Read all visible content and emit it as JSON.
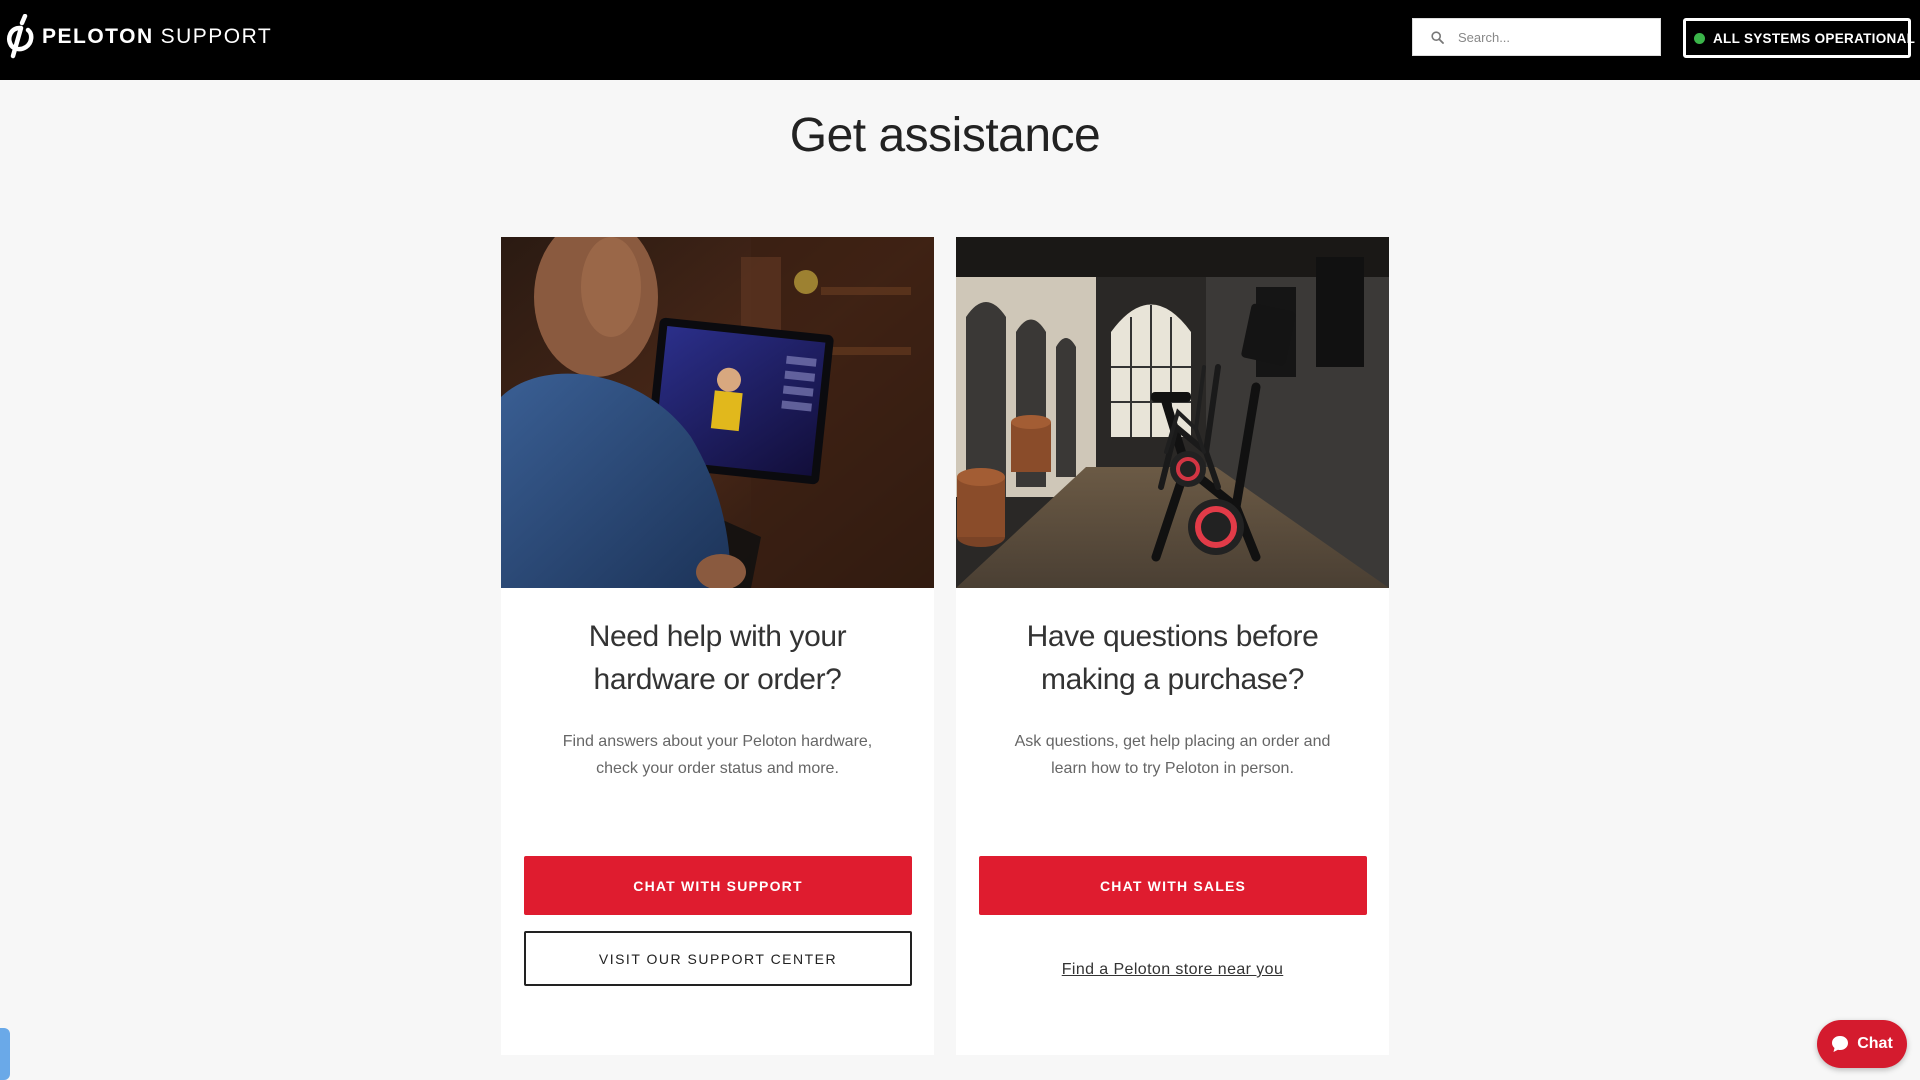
{
  "header": {
    "brand": "PELOTON",
    "brand_suffix": "SUPPORT",
    "search_placeholder": "Search...",
    "status_label": "ALL SYSTEMS OPERATIONAL"
  },
  "page": {
    "title": "Get assistance"
  },
  "cards": [
    {
      "heading_lines": [
        "Need help with your",
        "hardware or order?"
      ],
      "text_lines": [
        "Find answers about your Peloton hardware,",
        "check your order status and more."
      ],
      "primary_button": "CHAT WITH SUPPORT",
      "secondary_button": "VISIT OUR SUPPORT CENTER"
    },
    {
      "heading_lines": [
        "Have questions before",
        "making a purchase?"
      ],
      "text_lines": [
        "Ask questions, get help placing an order and",
        "learn how to try Peloton in person."
      ],
      "primary_button": "CHAT WITH SALES",
      "link": "Find a Peloton store near you"
    }
  ],
  "chat_widget": {
    "label": "Chat"
  },
  "colors": {
    "header_bg": "#000000",
    "accent_red": "#df1c2f",
    "status_green": "#3bb54a",
    "page_bg": "#f7f7f7"
  },
  "icons": [
    "peloton-logo-icon",
    "search-icon",
    "status-dot-icon",
    "chat-bubble-icon"
  ]
}
